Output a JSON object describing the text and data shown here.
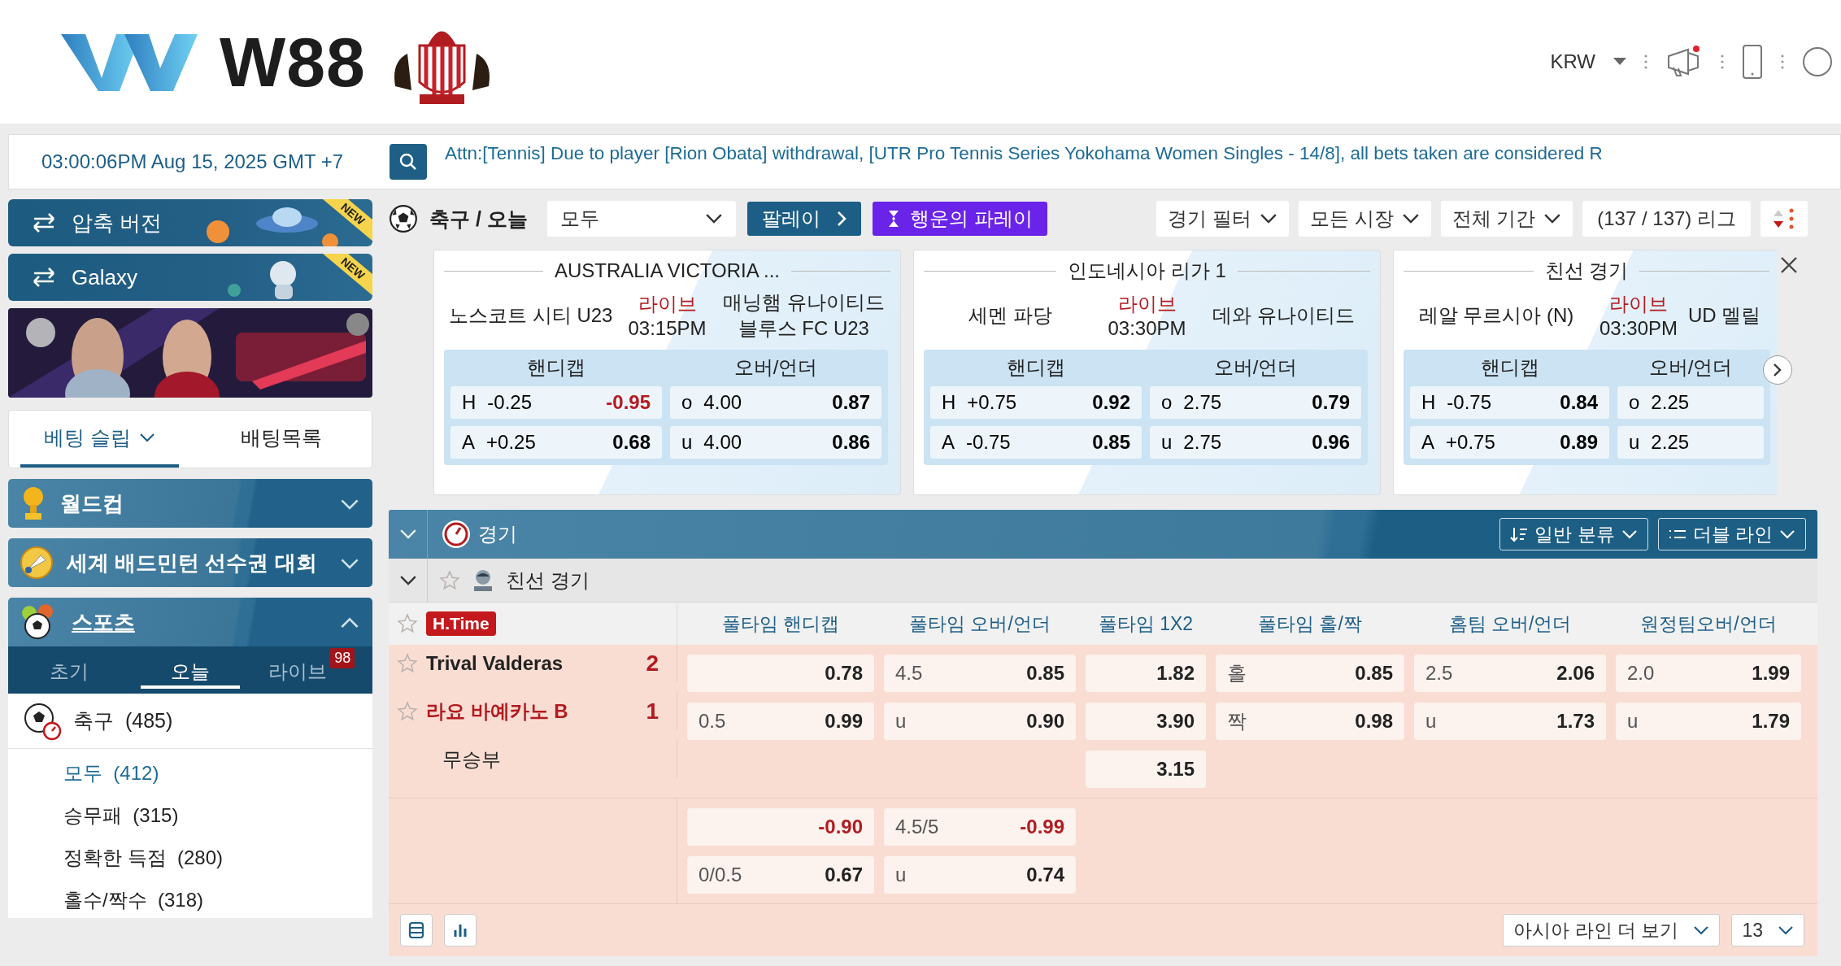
{
  "header": {
    "logo_text": "W88",
    "currency": "KRW"
  },
  "datetime": "03:00:06PM Aug 15, 2025 GMT +7",
  "ticker": "Attn:[Tennis] Due to player [Rion Obata] withdrawal, [UTR Pro Tennis Series Yokohama Women Singles - 14/8], all bets taken are considered R",
  "sidebar": {
    "promo_buttons": [
      {
        "label": "압축 버전",
        "badge": "NEW"
      },
      {
        "label": "Galaxy",
        "badge": "NEW"
      }
    ],
    "slip_tabs": [
      {
        "label": "베팅 슬립",
        "selected": true
      },
      {
        "label": "배팅목록",
        "selected": false
      }
    ],
    "categories": [
      {
        "label": "월드컵",
        "expanded": false
      },
      {
        "label": "세계 배드민턴 선수권 대회",
        "expanded": false
      }
    ],
    "sports": {
      "label": "스포츠",
      "expanded": true,
      "tabs": [
        {
          "label": "초기",
          "selected": false
        },
        {
          "label": "오늘",
          "selected": true
        },
        {
          "label": "라이브",
          "selected": false,
          "badge": "98"
        }
      ],
      "sport": {
        "label": "축구",
        "count": "(485)"
      },
      "items": [
        {
          "label": "모두",
          "count": "(412)",
          "selected": true
        },
        {
          "label": "승무패",
          "count": "(315)",
          "selected": false
        },
        {
          "label": "정확한 득점",
          "count": "(280)",
          "selected": false
        },
        {
          "label": "홀수/짝수",
          "count": "(318)",
          "selected": false
        }
      ]
    }
  },
  "toolbar": {
    "title": "축구 / 오늘",
    "market_select": "모두",
    "parlay_button": "팔레이",
    "lucky_button": "행운의 파레이",
    "filters": [
      "경기 필터",
      "모든 시장",
      "전체 기간"
    ],
    "league_count": "(137 / 137) 리그"
  },
  "cards": [
    {
      "league": "AUSTRALIA VICTORIA ...",
      "home": "노스코트 시티 U23",
      "away": "매닝햄 유나이티드 블루스 FC U23",
      "status": "라이브",
      "time": "03:15PM",
      "markets": [
        "핸디캡",
        "오버/언더"
      ],
      "handicap": [
        {
          "side": "H",
          "line": "-0.25",
          "odds": "-0.95",
          "red": true
        },
        {
          "side": "A",
          "line": "+0.25",
          "odds": "0.68",
          "red": false
        }
      ],
      "over_under": [
        {
          "side": "o",
          "line": "4.00",
          "odds": "0.87",
          "red": false
        },
        {
          "side": "u",
          "line": "4.00",
          "odds": "0.86",
          "red": false
        }
      ]
    },
    {
      "league": "인도네시아 리가 1",
      "home": "세멘 파당",
      "away": "데와 유나이티드",
      "status": "라이브",
      "time": "03:30PM",
      "markets": [
        "핸디캡",
        "오버/언더"
      ],
      "handicap": [
        {
          "side": "H",
          "line": "+0.75",
          "odds": "0.92",
          "red": false
        },
        {
          "side": "A",
          "line": "-0.75",
          "odds": "0.85",
          "red": false
        }
      ],
      "over_under": [
        {
          "side": "o",
          "line": "2.75",
          "odds": "0.79",
          "red": false
        },
        {
          "side": "u",
          "line": "2.75",
          "odds": "0.96",
          "red": false
        }
      ]
    },
    {
      "league": "친선 경기",
      "home": "레알 무르시아 (N)",
      "away": "UD 멜릴",
      "status": "라이브",
      "time": "03:30PM",
      "markets": [
        "핸디캡",
        "오버/언더"
      ],
      "handicap": [
        {
          "side": "H",
          "line": "-0.75",
          "odds": "0.84",
          "red": false
        },
        {
          "side": "A",
          "line": "+0.75",
          "odds": "0.89",
          "red": false
        }
      ],
      "over_under": [
        {
          "side": "o",
          "line": "2.25"
        },
        {
          "side": "u",
          "line": "2.25"
        }
      ]
    }
  ],
  "section": {
    "title": "경기",
    "expanded": true,
    "sort_button": "일반 분류",
    "line_button": "더블 라인"
  },
  "league": {
    "name": "친선 경기",
    "expanded": true
  },
  "status_badge": "H.Time",
  "columns": [
    "풀타임 핸디캡",
    "풀타임 오버/언더",
    "풀타임 1X2",
    "풀타임 홀/짝",
    "홈팀 오버/언더",
    "원정팀오버/언더"
  ],
  "teams": [
    {
      "name": "Trival Valderas",
      "score": "2",
      "red": false
    },
    {
      "name": "라요 바예카노 B",
      "score": "1",
      "red": true
    }
  ],
  "draw_label": "무승부",
  "lines": [
    [
      [
        {
          "odds": "0.78",
          "red": false
        },
        {
          "line": "4.5",
          "odds": "0.85",
          "red": false
        },
        {
          "odds": "1.82",
          "red": false
        },
        {
          "line": "홀",
          "odds": "0.85",
          "red": false
        },
        {
          "line": "2.5",
          "odds": "2.06",
          "red": false
        },
        {
          "line": "2.0",
          "odds": "1.99",
          "red": false
        }
      ],
      [
        {
          "line": "0.5",
          "odds": "0.99",
          "red": false
        },
        {
          "line": "u",
          "odds": "0.90",
          "red": false
        },
        {
          "odds": "3.90",
          "red": false
        },
        {
          "line": "짝",
          "odds": "0.98",
          "red": false
        },
        {
          "line": "u",
          "odds": "1.73",
          "red": false
        },
        {
          "line": "u",
          "odds": "1.79",
          "red": false
        }
      ],
      [
        {
          "kind": "empty"
        },
        {
          "kind": "empty"
        },
        {
          "odds": "3.15",
          "red": false
        },
        {
          "kind": "empty"
        },
        {
          "kind": "empty"
        },
        {
          "kind": "empty"
        }
      ]
    ],
    [
      [
        {
          "odds": "-0.90",
          "red": true
        },
        {
          "line": "4.5/5",
          "odds": "-0.99",
          "red": true
        },
        {
          "kind": "empty"
        },
        {
          "kind": "empty"
        },
        {
          "kind": "empty"
        },
        {
          "kind": "empty"
        }
      ],
      [
        {
          "line": "0/0.5",
          "odds": "0.67",
          "red": false
        },
        {
          "line": "u",
          "odds": "0.74",
          "red": false
        },
        {
          "kind": "empty"
        },
        {
          "kind": "empty"
        },
        {
          "kind": "empty"
        },
        {
          "kind": "empty"
        }
      ]
    ]
  ],
  "footer": {
    "more_lines": "아시아 라인 더 보기",
    "page_size": "13"
  }
}
